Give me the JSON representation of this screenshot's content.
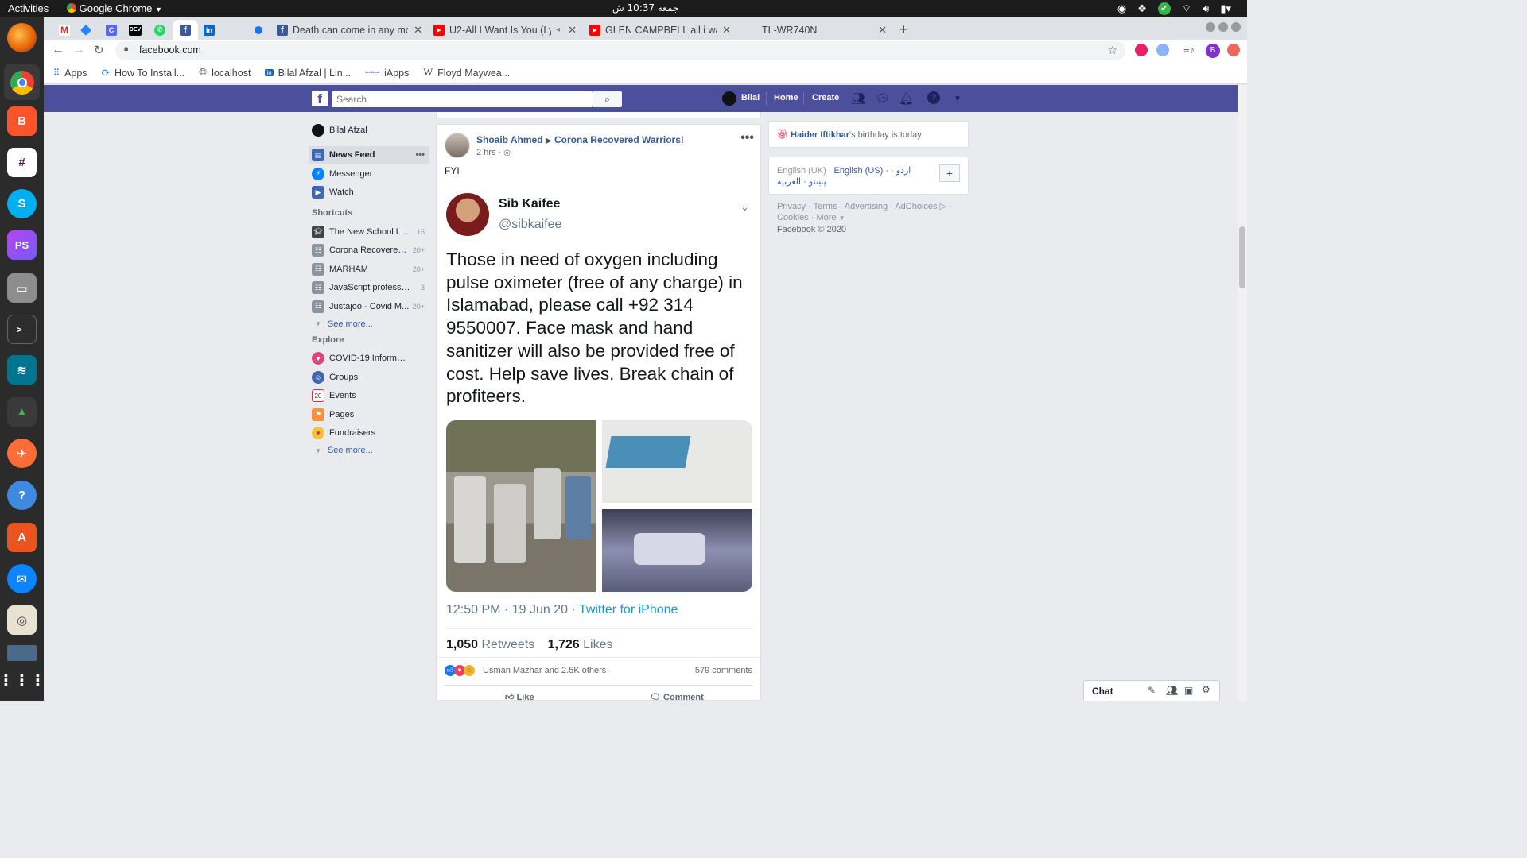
{
  "topbar": {
    "activities": "Activities",
    "app_name": "Google Chrome",
    "clock": "جمعه 10:37 ش"
  },
  "dock": {
    "items": [
      "Firefox",
      "Chrome",
      "Brave",
      "Slack",
      "Skype",
      "PhpStorm",
      "Files",
      "Terminal",
      "MySQL Workbench",
      "Robo 3T",
      "Postman",
      "Help",
      "Software",
      "Thunderbird",
      "Rhythmbox",
      "Screen",
      "Show Applications"
    ]
  },
  "browser": {
    "tabs": [
      {
        "title": "",
        "icon": "gmail-icon"
      },
      {
        "title": "",
        "icon": "jira-icon"
      },
      {
        "title": "",
        "icon": "c-icon"
      },
      {
        "title": "",
        "icon": "dev-icon"
      },
      {
        "title": "",
        "icon": "whatsapp-icon"
      },
      {
        "title": "",
        "icon": "facebook-icon"
      },
      {
        "title": "",
        "icon": "linkedin-icon"
      },
      {
        "title": "",
        "icon": "blank-icon"
      },
      {
        "title": "",
        "icon": "globe-icon"
      },
      {
        "title": "Death can come in any mo",
        "icon": "facebook-icon"
      },
      {
        "title": "U2-All I Want Is You (Ly",
        "icon": "youtube-icon"
      },
      {
        "title": "GLEN CAMPBELL all i wan",
        "icon": "youtube-icon"
      },
      {
        "title": "TL-WR740N",
        "icon": "blank-icon"
      }
    ],
    "url": "facebook.com",
    "profile_initial": "B",
    "bookmarks": [
      "Apps",
      "How To Install...",
      "localhost",
      "Bilal Afzal | Lin...",
      "iApps",
      "Floyd Maywea..."
    ]
  },
  "fb": {
    "search_placeholder": "Search",
    "user_short": "Bilal",
    "nav_home": "Home",
    "nav_create": "Create",
    "left": {
      "profile_name": "Bilal Afzal",
      "main": [
        {
          "label": "News Feed",
          "active": true
        },
        {
          "label": "Messenger"
        },
        {
          "label": "Watch"
        }
      ],
      "shortcuts_title": "Shortcuts",
      "shortcuts": [
        {
          "label": "The New School L...",
          "count": "15"
        },
        {
          "label": "Corona Recovered ...",
          "count": "20+"
        },
        {
          "label": "MARHAM",
          "count": "20+"
        },
        {
          "label": "JavaScript professi...",
          "count": "3"
        },
        {
          "label": "Justajoo - Covid M...",
          "count": "20+"
        }
      ],
      "see_more": "See more...",
      "explore_title": "Explore",
      "explore": [
        {
          "label": "COVID-19 Informat..."
        },
        {
          "label": "Groups"
        },
        {
          "label": "Events"
        },
        {
          "label": "Pages"
        },
        {
          "label": "Fundraisers"
        }
      ],
      "see_more2": "See more..."
    },
    "post": {
      "author": "Shoaib Ahmed",
      "group": "Corona Recovered Warriors!",
      "time": "2 hrs",
      "text": "FYI",
      "tweet": {
        "name": "Sib Kaifee",
        "handle": "@sibkaifee",
        "body": "Those in need of oxygen including pulse oximeter (free of any charge) in Islamabad, please call +92 314 9550007. Face mask and hand sanitizer will also be provided free of cost. Help save lives. Break chain of profiteers.",
        "timestamp": "12:50 PM · 19 Jun 20 · ",
        "source": "Twitter for iPhone",
        "retweets_num": "1,050",
        "retweets_label": "Retweets",
        "likes_num": "1,726",
        "likes_label": "Likes"
      },
      "reactions_text": "Usman Mazhar and 2.5K others",
      "comments_text": "579 comments",
      "like_label": "Like",
      "comment_label": "Comment"
    },
    "right": {
      "birthday_name": "Haider Iftikhar",
      "birthday_suffix": "'s birthday is today",
      "lang_current": "English (UK)",
      "lang_sep": " · ",
      "lang_alt": "English (US) · اردو · پښتو · العربية",
      "footer_line1": "Privacy · Terms · Advertising · AdChoices",
      "footer_line2": "Cookies · More",
      "copyright": "Facebook © 2020"
    },
    "chat_label": "Chat"
  },
  "colors": {
    "fb_header": "#4b4f9c",
    "fb_link": "#365899",
    "twitter_link": "#1b95e0"
  }
}
